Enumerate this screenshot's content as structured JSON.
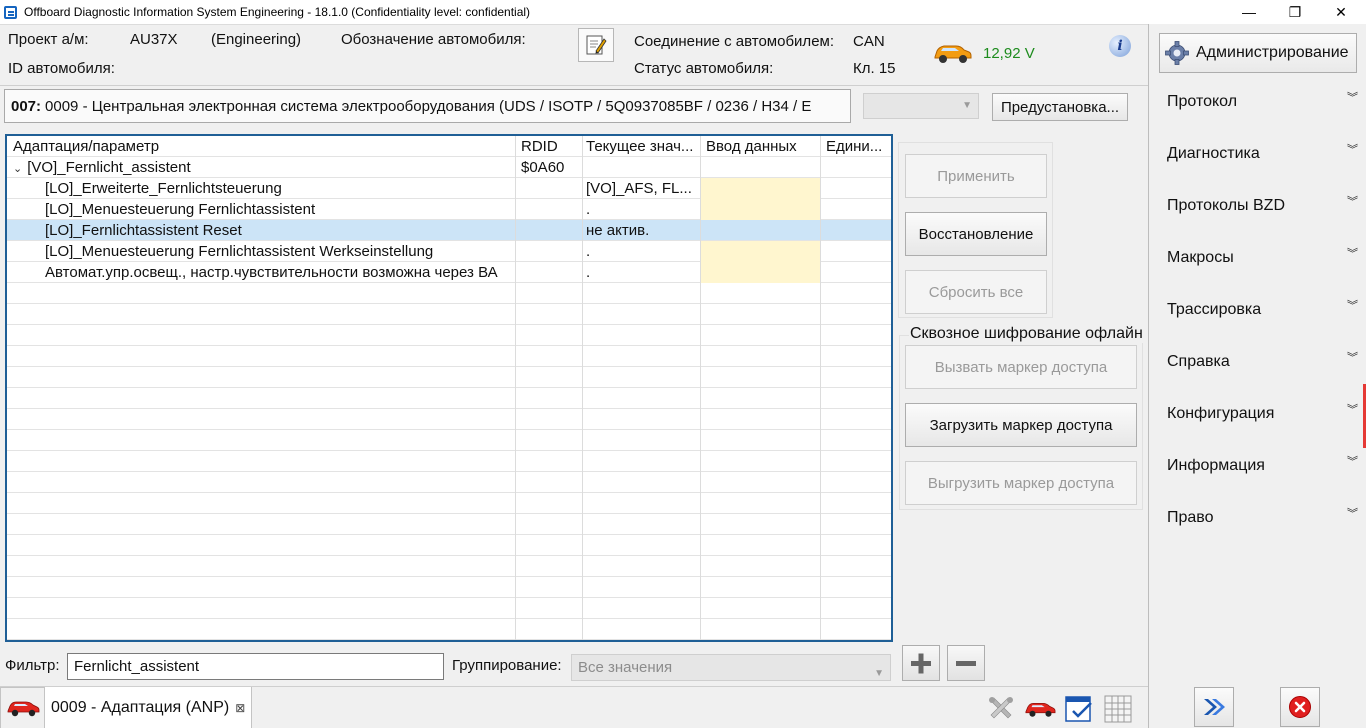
{
  "window": {
    "title": "Offboard Diagnostic Information System Engineering - 18.1.0 (Confidentiality level: confidential)",
    "minimize": "—",
    "maximize": "❐",
    "close": "✕"
  },
  "header": {
    "project_label": "Проект а/м:",
    "project_value": "AU37X",
    "project_mode": "(Engineering)",
    "designation_label": "Обозначение автомобиля:",
    "vehicle_id_label": "ID автомобиля:",
    "connection_label": "Соединение с автомобилем:",
    "connection_value": "CAN",
    "status_label": "Статус автомобиля:",
    "status_value": "Кл. 15",
    "voltage": "12,92 V",
    "info_icon_glyph": "i",
    "voltage_color": "#1e8c1e"
  },
  "sidebar": {
    "admin_label": "Администрирование",
    "items": [
      {
        "label": "Протокол"
      },
      {
        "label": "Диагностика"
      },
      {
        "label": "Протоколы BZD"
      },
      {
        "label": "Макросы"
      },
      {
        "label": "Трассировка"
      },
      {
        "label": "Справка"
      },
      {
        "label": "Конфигурация"
      },
      {
        "label": "Информация"
      },
      {
        "label": "Право"
      }
    ],
    "chevron_glyph": "»"
  },
  "ecu": {
    "address": "007:",
    "description": "0009 - Центральная электронная система электрооборудования  (UDS / ISOTP / 5Q0937085BF / 0236 / H34 / E"
  },
  "preset_button": "Предустановка...",
  "grid": {
    "columns": [
      "Адаптация/параметр",
      "RDID",
      "Текущее знач...",
      "Ввод данных",
      "Едини..."
    ],
    "expand_glyph": "⌄",
    "rows": [
      {
        "param": "[VO]_Fernlicht_assistent",
        "rdid": "$0A60",
        "current": "",
        "input": "",
        "unit": ""
      },
      {
        "param": "[LO]_Erweiterte_Fernlichtsteuerung",
        "rdid": "",
        "current": "[VO]_AFS, FL...",
        "input": "",
        "unit": ""
      },
      {
        "param": "[LO]_Menuesteuerung Fernlichtassistent",
        "rdid": "",
        "current": ".",
        "input": "",
        "unit": ""
      },
      {
        "param": "[LO]_Fernlichtassistent Reset",
        "rdid": "",
        "current": "не актив.",
        "input": "",
        "unit": ""
      },
      {
        "param": "[LO]_Menuesteuerung Fernlichtassistent Werkseinstellung",
        "rdid": "",
        "current": ".",
        "input": "",
        "unit": ""
      },
      {
        "param": "Автомат.упр.освещ., настр.чувствительности возможна через ВА",
        "rdid": "",
        "current": ".",
        "input": "",
        "unit": ""
      }
    ]
  },
  "actions": {
    "apply": "Применить",
    "restore": "Восстановление",
    "reset_all": "Сбросить все"
  },
  "e2e": {
    "title": "Сквозное шифрование офлайн",
    "call_token": "Вызвать маркер доступа",
    "load_token": "Загрузить маркер доступа",
    "unload_token": "Выгрузить маркер доступа"
  },
  "filter": {
    "label": "Фильтр:",
    "value": "Fernlicht_assistent",
    "group_label": "Группирование:",
    "group_value": "Все значения"
  },
  "tabs": {
    "active": "0009 - Адаптация (ANP)",
    "close_glyph": "⊠"
  }
}
